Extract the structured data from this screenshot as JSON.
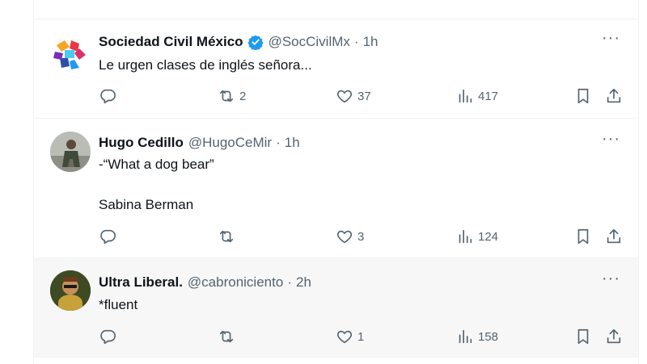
{
  "tweets": [
    {
      "name": "Sociedad Civil México",
      "verified": true,
      "handle": "@SocCivilMx",
      "dot": "·",
      "time": "1h",
      "text": "Le urgen clases de inglés señora...",
      "retweets": "2",
      "likes": "37",
      "views": "417",
      "avatar": "hands-logo-avatar"
    },
    {
      "name": "Hugo Cedillo",
      "verified": false,
      "handle": "@HugoCeMir",
      "dot": "·",
      "time": "1h",
      "text": "-“What a dog bear”\n\nSabina Berman",
      "retweets": "",
      "likes": "3",
      "views": "124",
      "avatar": "photo-avatar"
    },
    {
      "name": "Ultra Liberal.",
      "verified": false,
      "handle": "@cabroniciento",
      "dot": "·",
      "time": "2h",
      "text": "*fluent",
      "retweets": "",
      "likes": "1",
      "views": "158",
      "avatar": "photo-avatar"
    }
  ],
  "more_label": "···",
  "colors": {
    "text": "#0f1419",
    "secondary": "#536471",
    "verified": "#1d9bf0",
    "divider": "#eff3f4"
  }
}
